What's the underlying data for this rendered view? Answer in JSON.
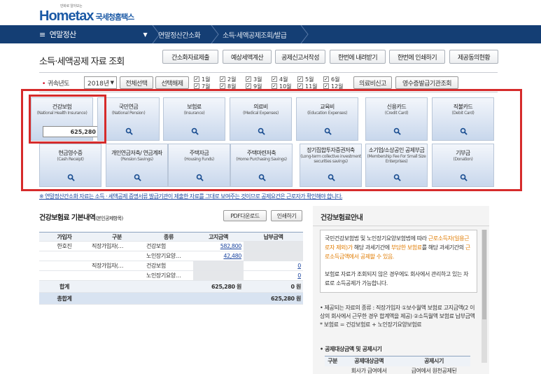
{
  "header": {
    "logo_small": "만화로 알아보는",
    "logo_main": "Hometax",
    "logo_kr": "국세청홈택스"
  },
  "nav": {
    "menu_label": "연말정산",
    "crumbs": [
      "연말정산간소화",
      "소득·세액공제조회/발급"
    ]
  },
  "page": {
    "title": "소득·세액공제 자료 조회"
  },
  "toolbar": [
    "간소화자료제출",
    "예상세액계산",
    "공제신고서작성",
    "한번에 내려받기",
    "한번에 인쇄하기",
    "제공동의현황"
  ],
  "filter": {
    "label": "귀속년도",
    "year": "2018년",
    "select_all": "전체선택",
    "deselect": "선택해제",
    "months": [
      "1월",
      "2월",
      "3월",
      "4월",
      "5월",
      "6월",
      "7월",
      "8월",
      "9월",
      "10월",
      "11월",
      "12월"
    ],
    "medical_report": "의료비신고",
    "receipt_issuer": "영수증발급기관조회"
  },
  "cards": [
    {
      "title": "건강보험",
      "en": "(National Health Insurance)",
      "amount": "625,280"
    },
    {
      "title": "국민연금",
      "en": "(National Pension)"
    },
    {
      "title": "보험료",
      "en": "(Insurance)"
    },
    {
      "title": "의료비",
      "en": "(Medical Expenses)"
    },
    {
      "title": "교육비",
      "en": "(Education Expenses)"
    },
    {
      "title": "신용카드",
      "en": "(Credit Card)"
    },
    {
      "title": "직불카드",
      "en": "(Debit Card)"
    },
    {
      "title": "현금영수증",
      "en": "(Cash Receipt)"
    },
    {
      "title": "개인연금저축/ 연금계좌",
      "en": "(Pension Savings)"
    },
    {
      "title": "주택자금",
      "en": "(Housing Funds)"
    },
    {
      "title": "주택마련저축",
      "en": "(Home Purchasing Savings)"
    },
    {
      "title": "장기집합투자증권저축",
      "en": "(Long-term collective investment securities savings)"
    },
    {
      "title": "소기업/소상공인 공제부금",
      "en": "(Membership Fee For Small Size Enterprises)"
    },
    {
      "title": "기부금",
      "en": "(Donation)"
    }
  ],
  "notice": "※ 연말정산간소화 자료는 소득 · 세액공제 증명서류 발급기관이 제출한 자료를 그대로 보여주는 것이므로 공제요건은 근로자가 확인해야 합니다.",
  "detail": {
    "title": "건강보험료 기본내역",
    "title_small": "(본인공제항목)",
    "pdf": "PDF다운로드",
    "print": "인쇄하기",
    "headers": [
      "가입자",
      "구분",
      "종류",
      "고지금액",
      "납부금액"
    ],
    "rows": [
      {
        "name": "한호진",
        "group": "직장가입자(…",
        "kind": "건강보험",
        "notice": "582,800",
        "paid": ""
      },
      {
        "name": "",
        "group": "",
        "kind": "노인장기요양…",
        "notice": "42,480",
        "paid": ""
      },
      {
        "name": "",
        "group": "직장가입자(…",
        "kind": "건강보험",
        "notice": "",
        "paid": "0"
      },
      {
        "name": "",
        "group": "",
        "kind": "노인장기요양…",
        "notice": "",
        "paid": "0"
      }
    ],
    "subtotal_label": "합계",
    "subtotal_notice": "625,280 원",
    "subtotal_paid": "0 원",
    "total_label": "총합계",
    "total_value": "625,280 원"
  },
  "guide": {
    "title": "건강보험료안내",
    "p1_a": "국민건강보험법 및 노인장기요양보험법에 따라 ",
    "p1_b": "근로소득자(일용근로자 제외)가",
    "p1_c": " 해당 과세기간에 ",
    "p1_d": "부담한 보험료",
    "p1_e": "를 해당 과세기간의 ",
    "p1_f": "근로소득금액에서 공제할 수 있음.",
    "p2": "보험료 자료가 조회되지 않은 경우에도 회사에서 관리하고 있는 자료로 소득공제가 가능합니다.",
    "b1": "• 제공되는 자료의 종류 : 직장가입자 ①보수월액 보험료 고지금액(2 이상의 회사에서 근무한 경우 합계액을 제공) ②소득월액 보험료 납부금액 * 보험료 = 건강보험료 + 노인장기요양보험료",
    "b2": "• 공제대상금액 및 공제시기",
    "t_headers": [
      "구분",
      "공제대상금액",
      "공제시기"
    ],
    "t_row": [
      "",
      "회사가 급여에서",
      "급여에서 원천공제된"
    ]
  }
}
